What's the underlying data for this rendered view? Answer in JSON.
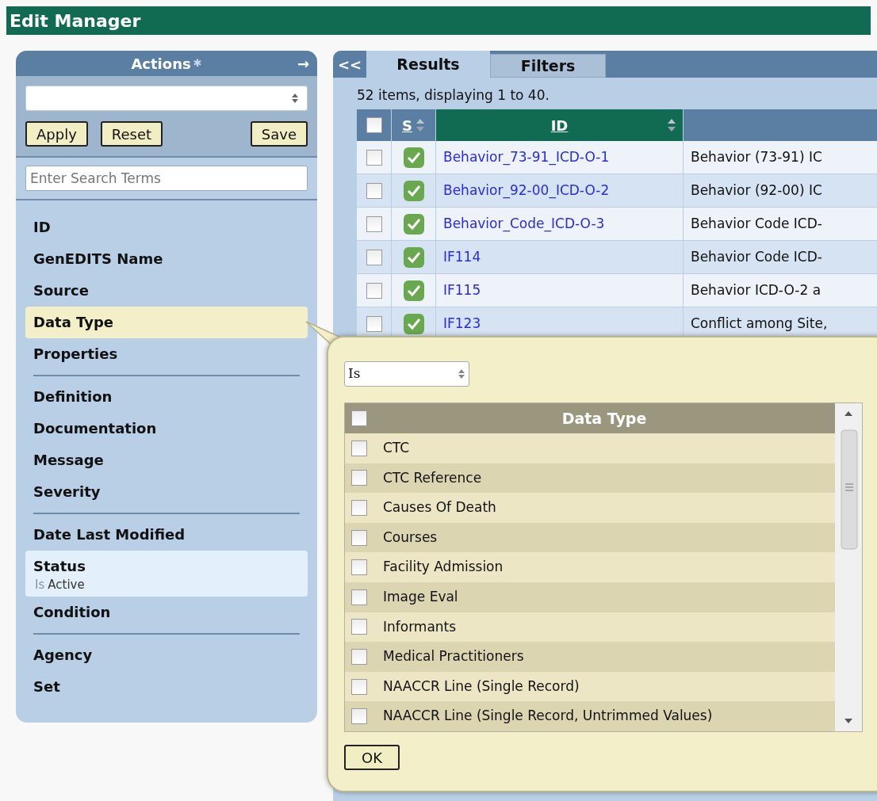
{
  "title": "Edit Manager",
  "actions_panel": {
    "title": "Actions",
    "title_mark": "✱",
    "collapse": "→",
    "buttons": [
      "Apply",
      "Reset",
      "Save"
    ],
    "search": {
      "placeholder": "Enter Search Terms"
    },
    "groups": [
      [
        {
          "label": "ID",
          "selected": false
        },
        {
          "label": "GenEDITS Name",
          "selected": false
        },
        {
          "label": "Source",
          "selected": false
        },
        {
          "label": "Data Type",
          "selected": true
        },
        {
          "label": "Properties",
          "selected": false
        }
      ],
      [
        {
          "label": "Definition",
          "selected": false
        },
        {
          "label": "Documentation",
          "selected": false
        },
        {
          "label": "Message",
          "selected": false
        },
        {
          "label": "Severity",
          "selected": false
        }
      ],
      [
        {
          "label": "Date Last Modified",
          "selected": false
        },
        {
          "label": "Status",
          "selected": false,
          "filter": {
            "operator": "Is",
            "value": "Active"
          }
        },
        {
          "label": "Condition",
          "selected": false
        }
      ],
      [
        {
          "label": "Agency",
          "selected": false
        },
        {
          "label": "Set",
          "selected": false
        }
      ]
    ]
  },
  "results_panel": {
    "collapse": "<<",
    "tabs": [
      {
        "label": "Results",
        "selected": true
      },
      {
        "label": "Filters",
        "selected": false
      }
    ],
    "summary": "52 items, displaying 1 to 40.",
    "header_checked": false,
    "columns": [
      {
        "label": "S",
        "sorted": false
      },
      {
        "label": "ID",
        "sorted": true
      }
    ],
    "rows": [
      {
        "checked": false,
        "active": true,
        "id": "Behavior_73-91_ICD-O-1",
        "description": "Behavior (73-91) IC"
      },
      {
        "checked": false,
        "active": true,
        "id": "Behavior_92-00_ICD-O-2",
        "description": "Behavior (92-00) IC"
      },
      {
        "checked": false,
        "active": true,
        "id": "Behavior_Code_ICD-O-3",
        "description": "Behavior Code ICD-"
      },
      {
        "checked": false,
        "active": true,
        "id": "IF114",
        "description": "Behavior Code ICD-"
      },
      {
        "checked": false,
        "active": true,
        "id": "IF115",
        "description": "Behavior ICD-O-2 a"
      },
      {
        "checked": false,
        "active": true,
        "id": "IF123",
        "description": "Conflict among Site,"
      }
    ]
  },
  "filter_popup": {
    "operator": "Is",
    "list_header": "Data Type",
    "header_checked": false,
    "options": [
      {
        "label": "CTC",
        "checked": false
      },
      {
        "label": "CTC Reference",
        "checked": false
      },
      {
        "label": "Causes Of Death",
        "checked": false
      },
      {
        "label": "Courses",
        "checked": false
      },
      {
        "label": "Facility Admission",
        "checked": false
      },
      {
        "label": "Image Eval",
        "checked": false
      },
      {
        "label": "Informants",
        "checked": false
      },
      {
        "label": "Medical Practitioners",
        "checked": false
      },
      {
        "label": "NAACCR Line (Single Record)",
        "checked": false
      },
      {
        "label": "NAACCR Line (Single Record, Untrimmed Values)",
        "checked": false
      }
    ],
    "button": "OK"
  }
}
